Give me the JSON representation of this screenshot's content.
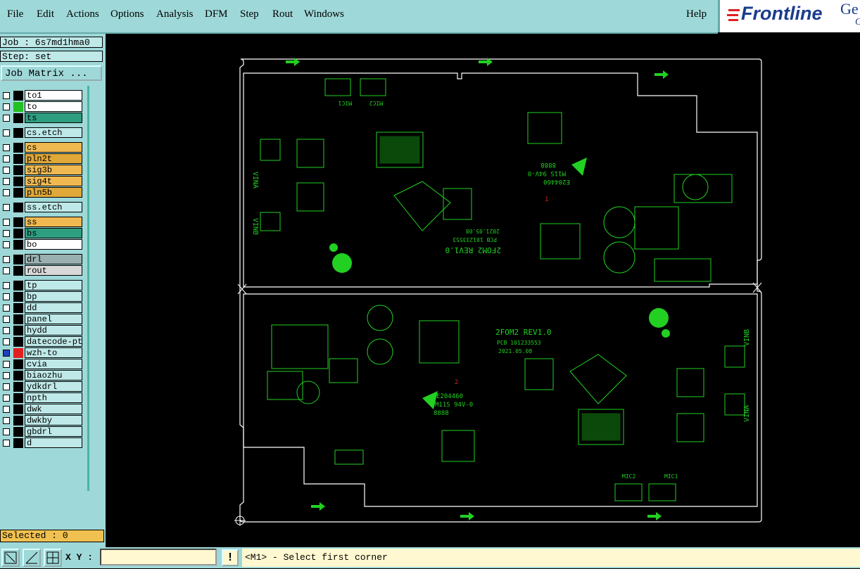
{
  "menu": {
    "items": [
      "File",
      "Edit",
      "Actions",
      "Options",
      "Analysis",
      "DFM",
      "Step",
      "Rout",
      "Windows"
    ],
    "help": "Help"
  },
  "logo": {
    "brand": "Frontline",
    "suffix": "Ge",
    "suffix2": "G"
  },
  "job": {
    "label": "Job : 6s7md1hma0",
    "step": "Step: set",
    "matrix_button": "Job Matrix ..."
  },
  "layers": [
    {
      "name": "to1",
      "color": "#ffffff",
      "swatch": "#000000"
    },
    {
      "name": "to",
      "color": "#ffffff",
      "swatch": "#22c022"
    },
    {
      "name": "ts",
      "color": "#2e9e80",
      "swatch": "#000000"
    },
    {
      "name": "cs.etch",
      "color": "#bfe8e8",
      "swatch": "#000000"
    },
    {
      "name": "cs",
      "color": "#f0b850",
      "swatch": "#000000"
    },
    {
      "name": "pln2t",
      "color": "#e0a838",
      "swatch": "#000000"
    },
    {
      "name": "sig3b",
      "color": "#f0b850",
      "swatch": "#000000"
    },
    {
      "name": "sig4t",
      "color": "#f0b850",
      "swatch": "#000000"
    },
    {
      "name": "pln5b",
      "color": "#e0a838",
      "swatch": "#000000"
    },
    {
      "name": "ss.etch",
      "color": "#bfe8e8",
      "swatch": "#000000"
    },
    {
      "name": "ss",
      "color": "#f0b850",
      "swatch": "#000000"
    },
    {
      "name": "bs",
      "color": "#2e9e80",
      "swatch": "#000000"
    },
    {
      "name": "bo",
      "color": "#ffffff",
      "swatch": "#000000"
    },
    {
      "name": "drl",
      "color": "#9ab0b0",
      "swatch": "#000000"
    },
    {
      "name": "rout",
      "color": "#d8d8d8",
      "swatch": "#000000"
    },
    {
      "name": "tp",
      "color": "#bfe8e8",
      "swatch": "#000000"
    },
    {
      "name": "bp",
      "color": "#bfe8e8",
      "swatch": "#000000"
    },
    {
      "name": "dd",
      "color": "#bfe8e8",
      "swatch": "#000000"
    },
    {
      "name": "panel",
      "color": "#bfe8e8",
      "swatch": "#000000"
    },
    {
      "name": "hydd",
      "color": "#bfe8e8",
      "swatch": "#000000"
    },
    {
      "name": "datecode-pto",
      "color": "#bfe8e8",
      "swatch": "#000000"
    },
    {
      "name": "wzh-to",
      "color": "#bfe8e8",
      "swatch": "#e02020",
      "active": true
    },
    {
      "name": "cvia",
      "color": "#bfe8e8",
      "swatch": "#000000"
    },
    {
      "name": "biaozhu",
      "color": "#bfe8e8",
      "swatch": "#000000"
    },
    {
      "name": "ydkdrl",
      "color": "#bfe8e8",
      "swatch": "#000000"
    },
    {
      "name": "npth",
      "color": "#bfe8e8",
      "swatch": "#000000"
    },
    {
      "name": "dwk",
      "color": "#bfe8e8",
      "swatch": "#000000"
    },
    {
      "name": "dwkby",
      "color": "#bfe8e8",
      "swatch": "#000000"
    },
    {
      "name": "gbdrl",
      "color": "#bfe8e8",
      "swatch": "#000000"
    },
    {
      "name": "d",
      "color": "#bfe8e8",
      "swatch": "#000000"
    }
  ],
  "selected": "Selected : 0",
  "xy_label": "X Y :",
  "status_text": "<M1> - Select first corner",
  "silk": {
    "top": {
      "title": "2FOM2 REV1.0",
      "pcb": "PCB 101233553",
      "date": "2021.05.08",
      "code": "E204460",
      "mark": "M11S 94V-0",
      "num": "8888",
      "index": "1",
      "vina": "VINA",
      "vinb": "VINB",
      "mic1": "MIC1",
      "mic2": "MIC2"
    },
    "bottom": {
      "title": "2FOM2 REV1.0",
      "pcb": "PCB 101233553",
      "date": "2021.05.08",
      "code": "E204460",
      "mark": "M11S 94V-0",
      "num": "8888",
      "index": "2",
      "vina": "VINA",
      "vinb": "VINB",
      "mic1": "MIC1",
      "mic2": "MIC2"
    }
  },
  "colors": {
    "silk": "#22d022",
    "outline": "#ffffff",
    "marker": "#e02020",
    "panel": "#9fd8d8"
  }
}
